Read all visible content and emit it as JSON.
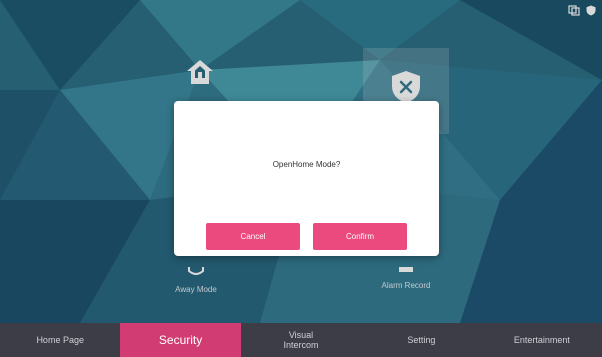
{
  "tiles": {
    "home": {
      "icon": "home-icon",
      "label": ""
    },
    "disarm": {
      "icon": "shield-x-icon",
      "label": ""
    },
    "away": {
      "icon": "away-icon",
      "label": "Away Mode"
    },
    "alarm": {
      "icon": "alarm-record-icon",
      "label": "Alarm Record"
    }
  },
  "status_icons": [
    "device-icon",
    "shield-icon"
  ],
  "dialog": {
    "message": "OpenHome Mode?",
    "cancel_label": "Cancel",
    "confirm_label": "Confirm"
  },
  "nav": {
    "items": [
      {
        "label": "Home Page",
        "active": false
      },
      {
        "label": "Security",
        "active": true
      },
      {
        "label_line1": "Visual",
        "label_line2": "Intercom",
        "active": false
      },
      {
        "label": "Setting",
        "active": false
      },
      {
        "label": "Entertainment",
        "active": false
      }
    ]
  },
  "colors": {
    "accent": "#ea4a7d",
    "nav_active": "#d13d72",
    "nav_bg": "#3d3d47",
    "background": "#2b6f88"
  }
}
